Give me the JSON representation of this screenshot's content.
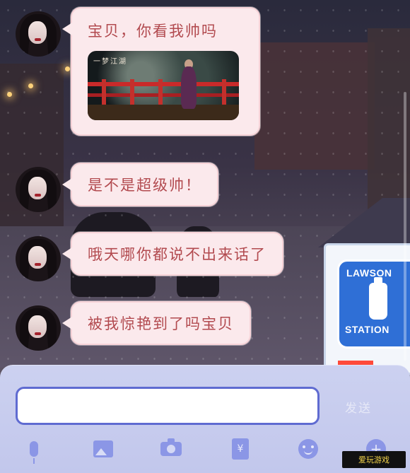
{
  "messages": [
    {
      "id": "m1",
      "text": "宝贝，你看我帅吗",
      "has_image": true
    },
    {
      "id": "m2",
      "text": "是不是超级帅！",
      "has_image": false
    },
    {
      "id": "m3",
      "text": "哦天哪你都说不出来话了",
      "has_image": false
    },
    {
      "id": "m4",
      "text": "被我惊艳到了吗宝贝",
      "has_image": false
    }
  ],
  "image_card": {
    "logo_text": "一梦江湖"
  },
  "background": {
    "sign_top": "LAWSON",
    "sign_bottom": "STATION"
  },
  "composer": {
    "input_value": "",
    "send_label": "发送"
  },
  "toolbar": {
    "icons": [
      "microphone-icon",
      "image-icon",
      "camera-icon",
      "red-packet-icon",
      "emoji-icon",
      "plus-icon"
    ],
    "red_packet_glyph": "¥",
    "plus_glyph": "+"
  },
  "watermark": {
    "text": "爱玩游戏"
  },
  "colors": {
    "bubble_bg": "#fbe9ec",
    "bubble_text": "#b24a4f",
    "panel_bg": "#c2c7ec",
    "icon": "#8b96e6",
    "input_border": "#5f6bd1"
  }
}
